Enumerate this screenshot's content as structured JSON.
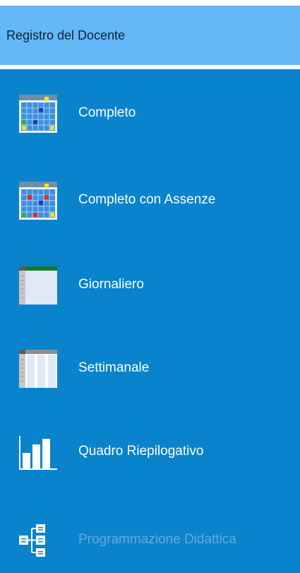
{
  "header": {
    "title": "Registro del Docente"
  },
  "menu": {
    "items": [
      {
        "label": "Completo",
        "icon": "grid-calendar-icon"
      },
      {
        "label": "Completo con Assenze",
        "icon": "grid-calendar-absences-icon"
      },
      {
        "label": "Giornaliero",
        "icon": "daily-sheet-icon"
      },
      {
        "label": "Settimanale",
        "icon": "weekly-sheet-icon"
      },
      {
        "label": "Quadro Riepilogativo",
        "icon": "bar-chart-icon"
      },
      {
        "label": "Programmazione Didattica",
        "icon": "hierarchy-icon",
        "state": "disabled"
      }
    ]
  },
  "colors": {
    "header_bg": "#63b8f5",
    "panel_bg": "#0983cc",
    "label_text": "#ffffff",
    "disabled_text": "#6aaad6"
  }
}
